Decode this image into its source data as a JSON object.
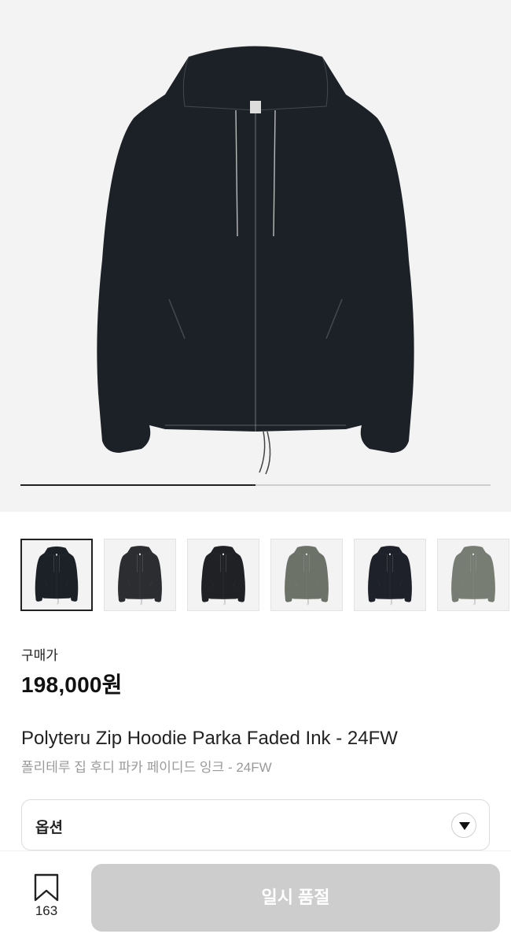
{
  "gallery": {
    "progress": 0.5,
    "thumbnails": [
      {
        "jacket_color": "#1c2128",
        "active": true
      },
      {
        "jacket_color": "#2b2d30",
        "active": false
      },
      {
        "jacket_color": "#1f2124",
        "active": false
      },
      {
        "jacket_color": "#6d7268",
        "active": false
      },
      {
        "jacket_color": "#1e2129",
        "active": false
      },
      {
        "jacket_color": "#777d72",
        "active": false
      }
    ]
  },
  "price": {
    "label": "구매가",
    "value": "198,000원"
  },
  "product": {
    "name": "Polyteru Zip Hoodie Parka Faded Ink - 24FW",
    "name_ko": "폴리테루 집 후디 파카 페이디드 잉크 - 24FW"
  },
  "option": {
    "label": "옵션",
    "icon": "chevron-down-icon"
  },
  "bottom": {
    "bookmark_count": "163",
    "bookmark_icon": "bookmark-icon",
    "button_label": "일시 품절"
  },
  "colors": {
    "jacket": "#1c2128",
    "button_disabled": "#cdcdcd",
    "hero_bg": "#f3f3f3"
  }
}
